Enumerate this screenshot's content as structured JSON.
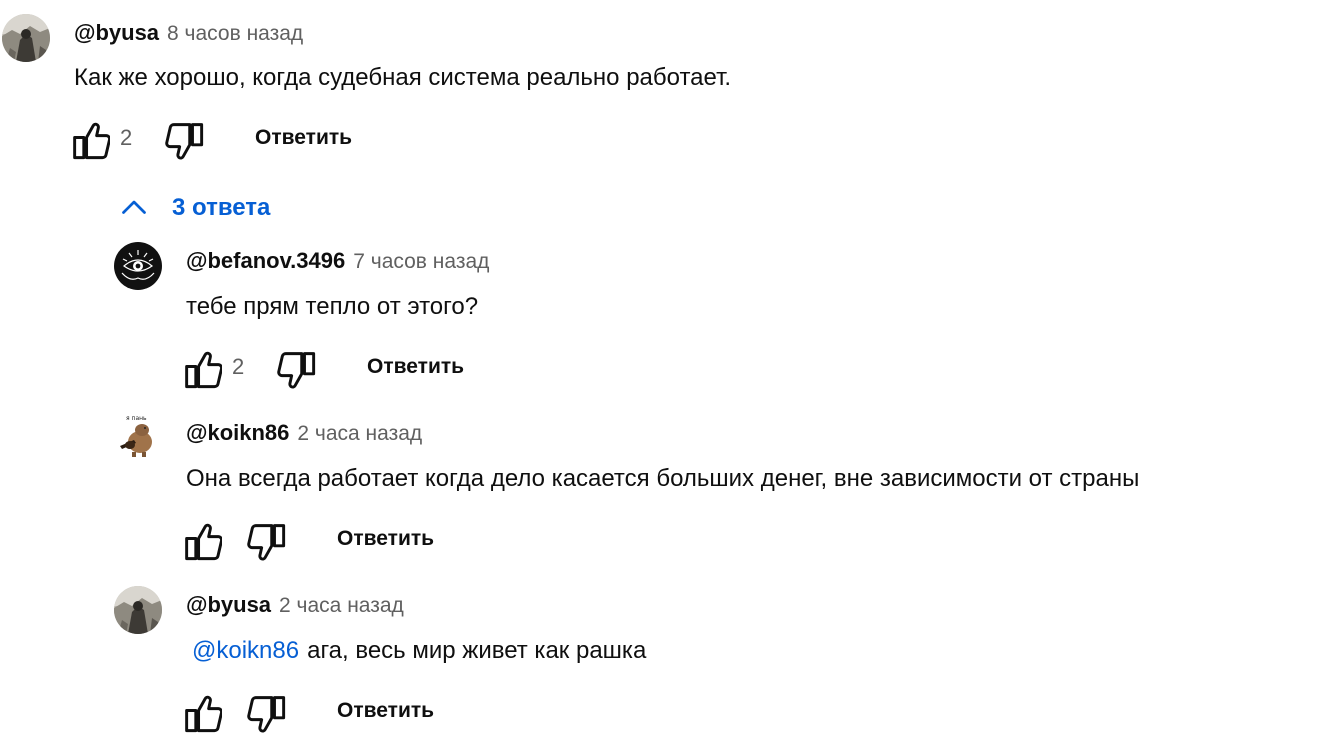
{
  "thread": {
    "top_comment": {
      "author": "@byusa",
      "time": "8 часов назад",
      "text": "Как же хорошо, когда судебная система реально работает.",
      "likes": "2",
      "reply_label": "Ответить",
      "avatar_icon": "user-avatar-photo"
    },
    "replies_toggle": {
      "label": "3 ответа",
      "icon": "chevron-up-icon"
    },
    "replies": [
      {
        "author": "@befanov.3496",
        "time": "7 часов назад",
        "text": "тебе прям тепло от этого?",
        "likes": "2",
        "reply_label": "Ответить",
        "avatar_icon": "eye-logo-avatar"
      },
      {
        "author": "@koikn86",
        "time": "2 часа назад",
        "text": "Она всегда работает когда дело касается больших денег, вне зависимости от страны",
        "likes": "",
        "reply_label": "Ответить",
        "avatar_icon": "capybara-guitar-avatar"
      },
      {
        "author": "@byusa",
        "time": "2 часа назад",
        "mention": "@koikn86",
        "text": "ага, весь мир живет как рашка",
        "likes": "",
        "reply_label": "Ответить",
        "avatar_icon": "user-avatar-photo"
      }
    ]
  },
  "colors": {
    "link": "#065fd4",
    "text": "#0f0f0f",
    "secondary": "#606060"
  }
}
